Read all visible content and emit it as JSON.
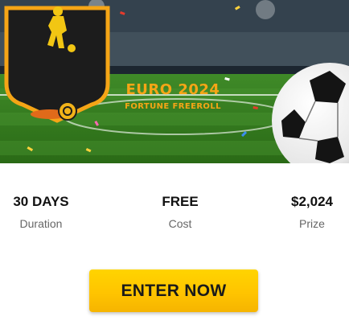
{
  "promo": {
    "title": "EURO 2024",
    "subtitle": "FORTUNE FREEROLL"
  },
  "stats": [
    {
      "value": "30 DAYS",
      "label": "Duration"
    },
    {
      "value": "FREE",
      "label": "Cost"
    },
    {
      "value": "$2,024",
      "label": "Prize"
    }
  ],
  "cta": {
    "label": "ENTER NOW"
  },
  "colors": {
    "badge_orange": "#f5a516",
    "button_yellow": "#ffc400",
    "pitch_green": "#2f7d1e"
  }
}
